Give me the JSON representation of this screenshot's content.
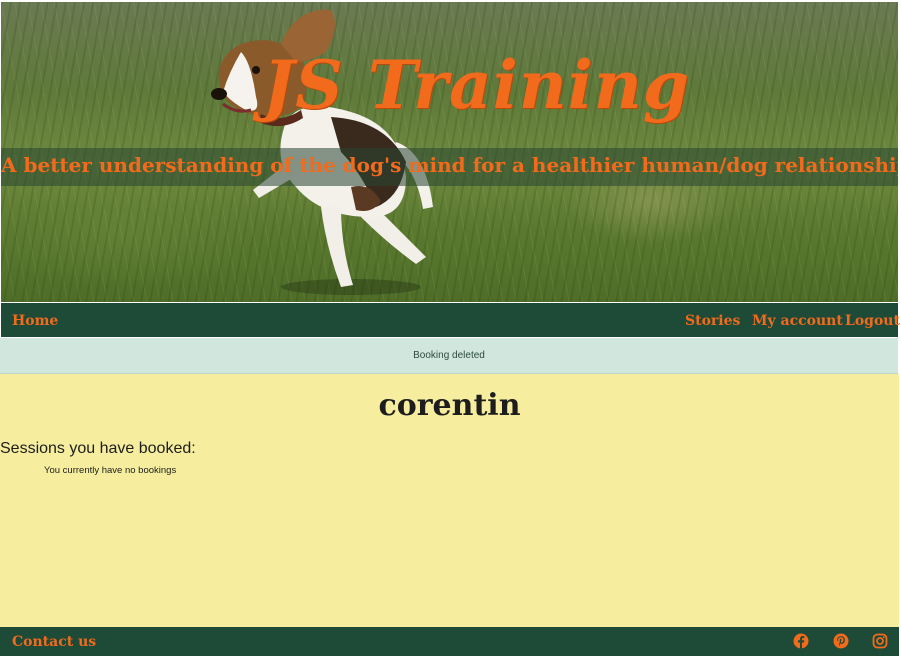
{
  "hero": {
    "title": "JS Training",
    "subtitle": "A better understanding of the dog's mind for a healthier human/dog relationship"
  },
  "nav": {
    "home": "Home",
    "stories": "Stories",
    "my_account": "My account",
    "logout": "Logout"
  },
  "alert": {
    "message": "Booking deleted"
  },
  "profile": {
    "username": "corentin",
    "sessions_heading": "Sessions you have booked:",
    "no_bookings": "You currently have no bookings"
  },
  "footer": {
    "contact": "Contact us",
    "social": [
      "facebook-icon",
      "pinterest-icon",
      "instagram-icon"
    ]
  },
  "colors": {
    "brand_green": "#1e4a38",
    "accent_orange": "#f26a1b",
    "main_bg": "#f6ee9e",
    "alert_bg": "#d1e6dd"
  }
}
